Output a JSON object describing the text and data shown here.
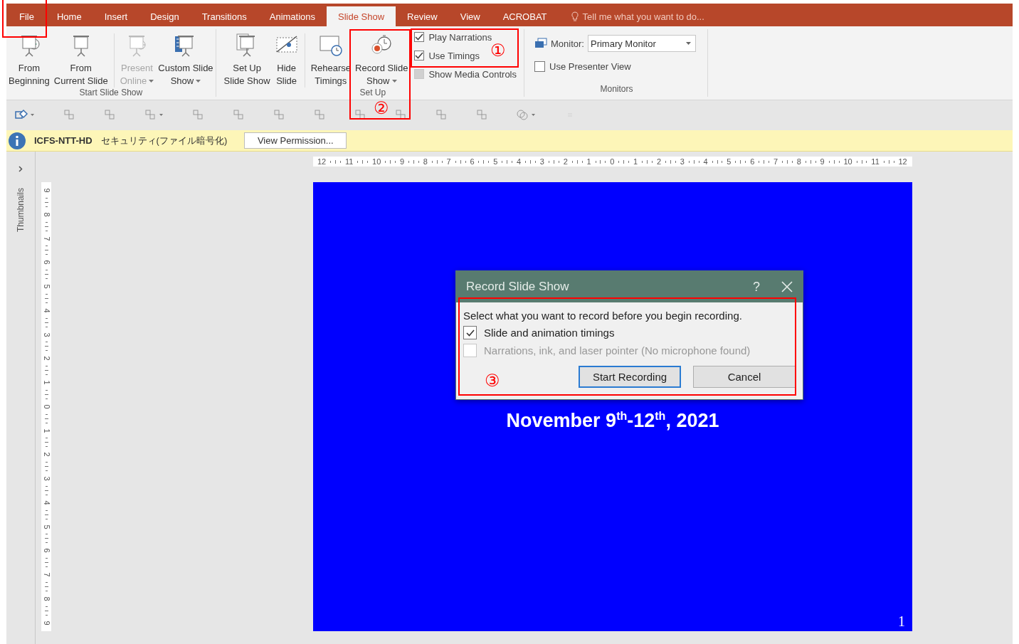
{
  "tabs": [
    {
      "label": "File",
      "selected": false
    },
    {
      "label": "Home",
      "selected": false
    },
    {
      "label": "Insert",
      "selected": false
    },
    {
      "label": "Design",
      "selected": false
    },
    {
      "label": "Transitions",
      "selected": false
    },
    {
      "label": "Animations",
      "selected": false
    },
    {
      "label": "Slide Show",
      "selected": true
    },
    {
      "label": "Review",
      "selected": false
    },
    {
      "label": "View",
      "selected": false
    },
    {
      "label": "ACROBAT",
      "selected": false
    }
  ],
  "tell_me": {
    "placeholder": "Tell me what you want to do..."
  },
  "ribbon": {
    "start_group": {
      "label": "Start Slide Show",
      "buttons": [
        {
          "lines": [
            "From",
            "Beginning"
          ],
          "disabled": false,
          "dropdown": false
        },
        {
          "lines": [
            "From",
            "Current Slide"
          ],
          "disabled": false,
          "dropdown": false
        },
        {
          "lines": [
            "Present",
            "Online"
          ],
          "disabled": true,
          "dropdown": true
        },
        {
          "lines": [
            "Custom Slide",
            "Show"
          ],
          "disabled": false,
          "dropdown": true
        }
      ]
    },
    "setup_group": {
      "label": "Set Up",
      "buttons": [
        {
          "lines": [
            "Set Up",
            "Slide Show"
          ],
          "disabled": false,
          "dropdown": false
        },
        {
          "lines": [
            "Hide",
            "Slide"
          ],
          "disabled": false,
          "dropdown": false
        },
        {
          "lines": [
            "Rehearse",
            "Timings"
          ],
          "disabled": false,
          "dropdown": false
        },
        {
          "lines": [
            "Record Slide",
            "Show"
          ],
          "disabled": false,
          "dropdown": true
        }
      ],
      "checkboxes": [
        {
          "label": "Play Narrations",
          "checked": true,
          "disabled": false
        },
        {
          "label": "Use Timings",
          "checked": true,
          "disabled": false
        },
        {
          "label": "Show Media Controls",
          "checked": false,
          "disabled": true
        }
      ]
    },
    "monitors_group": {
      "label": "Monitors",
      "monitor_label": "Monitor:",
      "monitor_value": "Primary Monitor",
      "checkboxes": [
        {
          "label": "Use Presenter View",
          "checked": false,
          "disabled": false
        }
      ]
    }
  },
  "info_bar": {
    "account": "ICFS-NTT-HD",
    "message": "セキュリティ(ファイル暗号化)",
    "button": "View Permission..."
  },
  "thumbnails_label": "Thumbnails",
  "horizontal_ruler": [
    "12",
    "11",
    "10",
    "9",
    "8",
    "7",
    "6",
    "5",
    "4",
    "3",
    "2",
    "1",
    "0",
    "1",
    "2",
    "3",
    "4",
    "5",
    "6",
    "7",
    "8",
    "9",
    "10",
    "11",
    "12"
  ],
  "vertical_ruler": [
    "9",
    "8",
    "7",
    "6",
    "5",
    "4",
    "3",
    "2",
    "1",
    "0",
    "1",
    "2",
    "3",
    "4",
    "5",
    "6",
    "7",
    "8",
    "9"
  ],
  "slide": {
    "subtitle": "November 9$^{th}$-12$^{th}$, 2021",
    "number": "1"
  },
  "dialog": {
    "title": "Record Slide Show",
    "help": "?",
    "instruction": "Select what you want to record before you begin recording.",
    "options": [
      {
        "label": "Slide and animation timings",
        "checked": true,
        "disabled": false
      },
      {
        "label": "Narrations, ink, and laser pointer (No microphone found)",
        "checked": false,
        "disabled": true
      }
    ],
    "buttons": [
      {
        "label": "Start Recording",
        "default": true
      },
      {
        "label": "Cancel",
        "default": false
      }
    ]
  },
  "annotations": [
    {
      "kind": "frame"
    },
    {
      "kind": "numbered",
      "label": "①"
    },
    {
      "kind": "numbered",
      "label": "②"
    },
    {
      "kind": "numbered",
      "label": "③"
    }
  ]
}
